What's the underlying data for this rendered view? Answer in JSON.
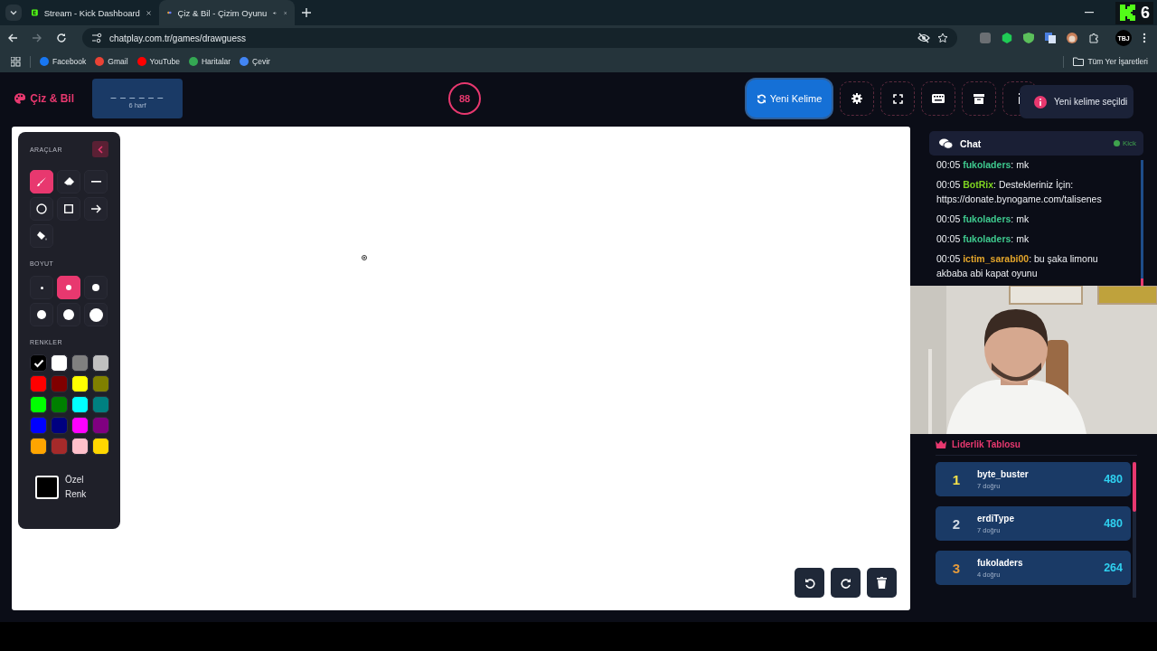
{
  "browser": {
    "tabs": [
      {
        "title": "Stream - Kick Dashboard",
        "selected": false
      },
      {
        "title": "Çiz & Bil - Çizim Oyunu",
        "selected": true
      }
    ],
    "address": "chatplay.com.tr/games/drawguess",
    "bookmarks": [
      {
        "label": "Facebook",
        "color": "#1877f2"
      },
      {
        "label": "Gmail",
        "color": "#ea4335"
      },
      {
        "label": "YouTube",
        "color": "#ff0000"
      },
      {
        "label": "Haritalar",
        "color": "#34a853"
      },
      {
        "label": "Çevir",
        "color": "#4285f4"
      }
    ],
    "all_bookmarks": "Tüm Yer İşaretleri",
    "profile": "TBJ",
    "overlay_count": "6"
  },
  "header": {
    "logo": "Çiz & Bil",
    "word_mask": "_ _ _ _ _ _",
    "word_length": "6 harf",
    "timer": "88",
    "new_word_button": "Yeni Kelime",
    "toolbar": [
      {
        "kind": "settings"
      },
      {
        "kind": "fullscreen"
      },
      {
        "kind": "keyboard"
      },
      {
        "kind": "archive"
      },
      {
        "kind": "info"
      }
    ],
    "toast": "Yeni kelime seçildi"
  },
  "tools_panel": {
    "tools_title": "ARAÇLAR",
    "tools": [
      {
        "kind": "brush",
        "selected": true
      },
      {
        "kind": "eraser",
        "selected": false
      },
      {
        "kind": "line",
        "selected": false
      },
      {
        "kind": "circle",
        "selected": false
      },
      {
        "kind": "rectangle",
        "selected": false
      },
      {
        "kind": "arrow",
        "selected": false
      },
      {
        "kind": "fill",
        "selected": false
      }
    ],
    "size_title": "BOYUT",
    "sizes": [
      {
        "selected": false
      },
      {
        "selected": true
      },
      {
        "selected": false
      },
      {
        "selected": false
      },
      {
        "selected": false
      },
      {
        "selected": false
      }
    ],
    "colors_title": "RENKLER",
    "colors": [
      {
        "color": "#000000",
        "selected": true
      },
      {
        "color": "#ffffff",
        "selected": false
      },
      {
        "color": "#808080",
        "selected": false
      },
      {
        "color": "#c0c0c0",
        "selected": false
      },
      {
        "color": "#ff0000",
        "selected": false
      },
      {
        "color": "#800000",
        "selected": false
      },
      {
        "color": "#ffff00",
        "selected": false
      },
      {
        "color": "#808000",
        "selected": false
      },
      {
        "color": "#00ff00",
        "selected": false
      },
      {
        "color": "#008000",
        "selected": false
      },
      {
        "color": "#00ffff",
        "selected": false
      },
      {
        "color": "#008080",
        "selected": false
      },
      {
        "color": "#0000ff",
        "selected": false
      },
      {
        "color": "#000080",
        "selected": false
      },
      {
        "color": "#ff00ff",
        "selected": false
      },
      {
        "color": "#800080",
        "selected": false
      },
      {
        "color": "#ffa500",
        "selected": false
      },
      {
        "color": "#a52a2a",
        "selected": false
      },
      {
        "color": "#ffc0cb",
        "selected": false
      },
      {
        "color": "#ffd700",
        "selected": false
      }
    ],
    "custom_color": {
      "label": "Özel Renk",
      "color": "#000000"
    }
  },
  "canvas_actions": [
    {
      "kind": "undo"
    },
    {
      "kind": "redo"
    },
    {
      "kind": "clear"
    }
  ],
  "chat": {
    "title": "Chat",
    "platform": "Kick",
    "messages": [
      {
        "time": "00:05",
        "user": "fukoladers",
        "color": "#3ec98e",
        "text": ": mk"
      },
      {
        "time": "00:05",
        "user": "BotRix",
        "color": "#7ed321",
        "text": ": Destekleriniz İçin: https://donate.bynogame.com/talisenes"
      },
      {
        "time": "00:05",
        "user": "fukoladers",
        "color": "#3ec98e",
        "text": ": mk"
      },
      {
        "time": "00:05",
        "user": "fukoladers",
        "color": "#3ec98e",
        "text": ": mk"
      },
      {
        "time": "00:05",
        "user": "ictim_sarabi00",
        "color": "#e3a52b",
        "text": ": bu şaka limonu akbaba abi kapat oyunu"
      }
    ]
  },
  "leaderboard": {
    "title": "Liderlik Tablosu",
    "entries": [
      {
        "rank": "1",
        "name": "byte_buster",
        "correct": "7 doğru",
        "score": "480",
        "color": "#f5e14a"
      },
      {
        "rank": "2",
        "name": "erdiType",
        "correct": "7 doğru",
        "score": "480",
        "color": "#cfd8e3"
      },
      {
        "rank": "3",
        "name": "fukoladers",
        "correct": "4 doğru",
        "score": "264",
        "color": "#e39a3c"
      }
    ]
  }
}
